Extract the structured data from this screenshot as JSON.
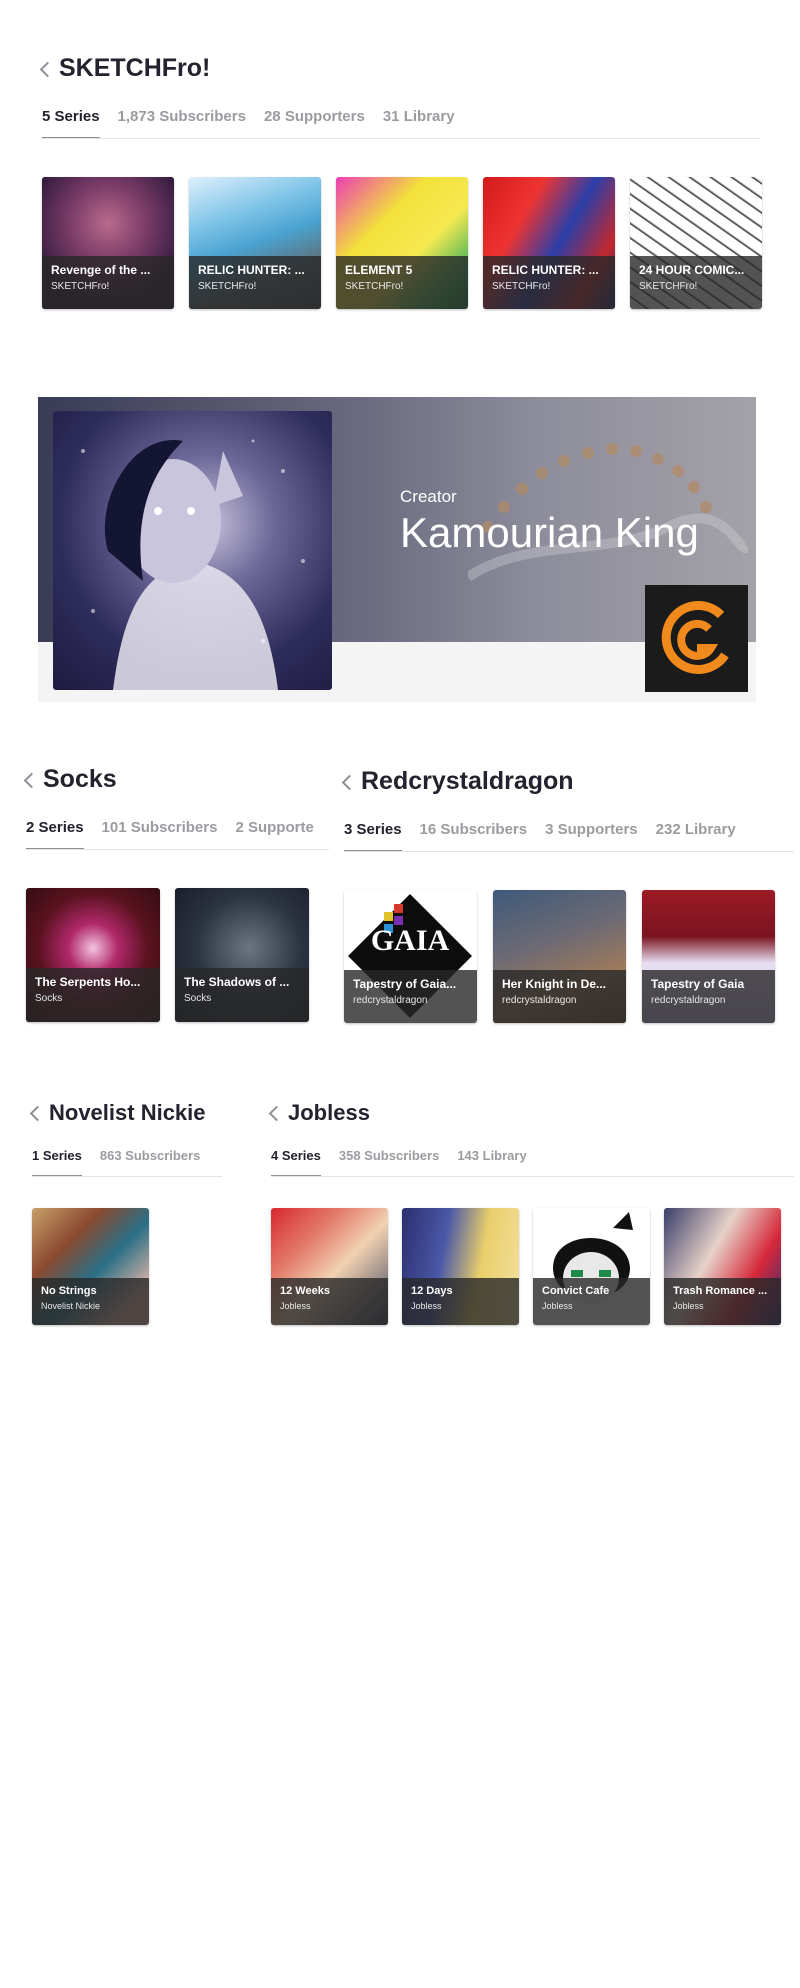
{
  "sections": {
    "sketchfro": {
      "name": "SKETCHFro!",
      "tabs": [
        "5 Series",
        "1,873 Subscribers",
        "28 Supporters",
        "31 Library"
      ],
      "series": [
        {
          "title": "Revenge of the ...",
          "author": "SKETCHFro!"
        },
        {
          "title": "RELIC HUNTER: ...",
          "author": "SKETCHFro!"
        },
        {
          "title": "ELEMENT 5",
          "author": "SKETCHFro!"
        },
        {
          "title": "RELIC HUNTER: ...",
          "author": "SKETCHFro!"
        },
        {
          "title": "24 HOUR COMIC...",
          "author": "SKETCHFro!"
        }
      ]
    },
    "socks": {
      "name": "Socks",
      "tabs": [
        "2 Series",
        "101 Subscribers",
        "2 Supporte"
      ],
      "series": [
        {
          "title": "The Serpents Ho...",
          "author": "Socks"
        },
        {
          "title": "The Shadows of ...",
          "author": "Socks"
        }
      ]
    },
    "redcrystaldragon": {
      "name": "Redcrystaldragon",
      "tabs": [
        "3 Series",
        "16 Subscribers",
        "3 Supporters",
        "232 Library"
      ],
      "series": [
        {
          "title": "Tapestry of Gaia...",
          "author": "redcrystaldragon"
        },
        {
          "title": "Her Knight in De...",
          "author": "redcrystaldragon"
        },
        {
          "title": "Tapestry of Gaia",
          "author": "redcrystaldragon"
        }
      ]
    },
    "nickie": {
      "name": "Novelist Nickie",
      "tabs": [
        "1 Series",
        "863 Subscribers"
      ],
      "series": [
        {
          "title": "No Strings",
          "author": "Novelist Nickie"
        }
      ]
    },
    "jobless": {
      "name": "Jobless",
      "tabs": [
        "4 Series",
        "358 Subscribers",
        "143 Library"
      ],
      "series": [
        {
          "title": "12 Weeks",
          "author": "Jobless"
        },
        {
          "title": "12 Days",
          "author": "Jobless"
        },
        {
          "title": "Convict Cafe",
          "author": "Jobless"
        },
        {
          "title": "Trash Romance ...",
          "author": "Jobless"
        }
      ]
    }
  },
  "banner": {
    "role": "Creator",
    "name": "Kamourian King",
    "logo_icon": "logo-icon",
    "logo_color": "#f08a1c"
  },
  "colors": {
    "text": "#23222e",
    "muted": "#9b9ba0",
    "overlay": "#282828"
  }
}
